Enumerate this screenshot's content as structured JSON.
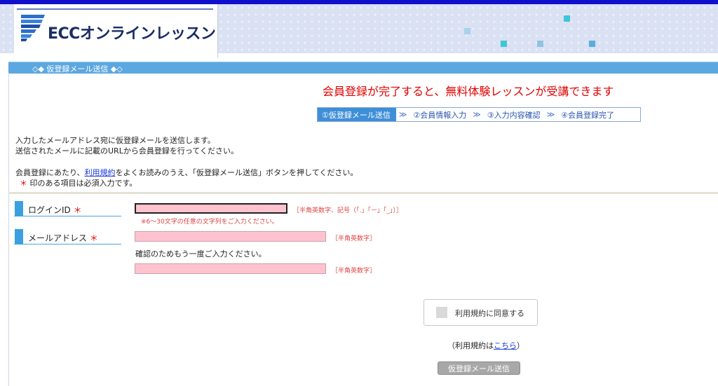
{
  "header": {
    "logo_text": "ECCオンラインレッスン"
  },
  "page_band": {
    "title": "◇◆ 仮登録メール送信 ◆◇"
  },
  "promo": {
    "text": "会員登録が完了すると、無料体験レッスンが受講できます"
  },
  "steps": [
    {
      "label": "①仮登録メール送信",
      "active": true
    },
    {
      "label": "②会員情報入力",
      "active": false
    },
    {
      "label": "③入力内容確認",
      "active": false
    },
    {
      "label": "④会員登録完了",
      "active": false
    }
  ],
  "step_separator": "≫",
  "intro": {
    "line1": "入力したメールアドレス宛に仮登録メールを送信します。",
    "line2": "送信されたメールに記載のURLから会員登録を行ってください。",
    "line3_pre": "会員登録にあたり、",
    "line3_link": "利用規約",
    "line3_post": "をよくお読みのうえ、「仮登録メール送信」ボタンを押してください。",
    "line4_mark": "＊",
    "line4_text": " 印のある項目は必須入力です。"
  },
  "form": {
    "login_id": {
      "label": "ログインID",
      "required_mark": "＊",
      "value": "",
      "hint": "［半角英数字、記号（「.」「－」「_」）］",
      "note": "※6～30文字の任意の文字列をご入力ください。"
    },
    "email": {
      "label": "メールアドレス",
      "required_mark": "＊",
      "value": "",
      "hint": "［半角英数字］",
      "confirm_text": "確認のためもう一度ご入力ください。",
      "confirm_value": "",
      "confirm_hint": "［半角英数字］"
    }
  },
  "agree": {
    "label": "利用規約に同意する",
    "checked": false
  },
  "terms_note": {
    "pre": "（利用規約は",
    "link": "こちら",
    "post": "）"
  },
  "submit": {
    "label": "仮登録メール送信"
  },
  "colors": {
    "top_bar": "#1010cc",
    "band_blue": "#5ca7e0",
    "accent_red": "#e00000",
    "input_pink": "#ffc3cf",
    "label_bar": "#3aa0e0",
    "deco_teal": "#3cc7d6"
  }
}
